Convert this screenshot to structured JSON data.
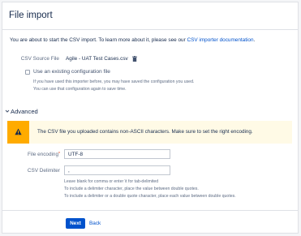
{
  "page": {
    "title": "File import",
    "intro_text": "You are about to start the CSV import. To learn more about it, please see our ",
    "intro_link": "CSV importer documentation",
    "intro_end": "."
  },
  "source": {
    "label": "CSV Source File",
    "filename": "Agile - UAT Test Cases.csv",
    "delete_icon": "trash-icon"
  },
  "existing_config": {
    "checkbox_label": "Use an existing configuration file",
    "checked": false,
    "help_line1": "If you have used this importer before, you may have saved the configuration you used.",
    "help_line2": "You can use that configuration again to save time."
  },
  "advanced": {
    "header": "Advanced",
    "expanded": true,
    "warning": {
      "icon": "warning-icon",
      "text": "The CSV file you uploaded contains non-ASCII characters. Make sure to set the right encoding."
    },
    "encoding": {
      "label": "File encoding",
      "required_mark": "*",
      "value": "UTF-8"
    },
    "delimiter": {
      "label": "CSV Delimiter",
      "value": ",",
      "help_line1": "Leave blank for comma or enter \\t for tab-delimited",
      "help_line2": "To include a delimiter character, place the value between double quotes.",
      "help_line3": "To include a delimiter or a double quote character, place each value between double quotes."
    }
  },
  "actions": {
    "next_label": "Next",
    "back_label": "Back"
  },
  "colors": {
    "primary": "#0052cc",
    "warning_strip": "#ffab00",
    "warning_bg": "#fffae6"
  }
}
